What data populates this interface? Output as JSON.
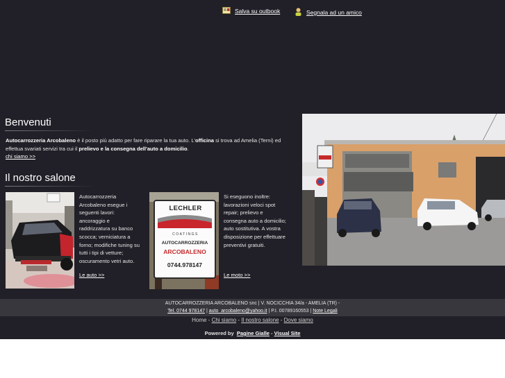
{
  "top_links": {
    "outlook": "Salva su outbook",
    "friend": "Segnala ad un amico"
  },
  "welcome": {
    "title": "Benvenuti",
    "brand": "Autocarrozzeria Arcobaleno",
    "text_a": " è il posto più adatto per fare riparare la tua auto. L'",
    "officina": "officina",
    "text_b": " si trova ad Amelia (Terni) ed effettua svariati servizi tra cui il ",
    "bold_tail": "prelievo e la consegna dell'auto a domicilio",
    "text_c": ".",
    "link": "chi siamo >>"
  },
  "salone": {
    "title": "Il nostro salone",
    "auto_text": "Autocarrozzeria Arcobaleno esegue i seguenti lavori: ancoraggio e raddrizzatura su banco scocca; verniciatura a forno; modifiche tuning su tutti i tipi di vetture; oscuramento vetri auto.",
    "auto_link": "Le auto >>",
    "moto_text": "Si eseguono inoltre: lavorazioni veloci spot repair; prelievo e consegna auto a domicilio; auto sostitutiva. A vostra disposizione per effettuare preventivi gratuiti.",
    "moto_link": "Le moto >>"
  },
  "sign": {
    "brand": "LECHLER",
    "sub": "COATINGS",
    "line1": "AUTOCARROZZERIA",
    "line2": "ARCOBALENO",
    "phone": "0744.978147"
  },
  "footer": {
    "company": "AUTOCARROZZERIA ARCOBALENO snc | V. NOCICCHIA 34/a - AMELIA (TR) -",
    "tel": "Tel. 0744 978147",
    "sep1": " | ",
    "email": "auto_arcobaleno@yahoo.it",
    "piva": " | P.I. 00789160553 | ",
    "legal": "Note Legali"
  },
  "nav": {
    "home": "Home",
    "chi_siamo": "Chi siamo",
    "salone": "Il nostro salone",
    "dove": "Dove siamo",
    "sep": " - "
  },
  "powered": {
    "label": "Powered by",
    "pagine": "Pagine Gialle",
    "sep": " - ",
    "visual": "Visual Site"
  },
  "colors": {
    "background": "#212028",
    "footer_band": "#37373d",
    "text": "#e8e8e8"
  },
  "icons": [
    "outlook-icon",
    "friend-icon"
  ]
}
